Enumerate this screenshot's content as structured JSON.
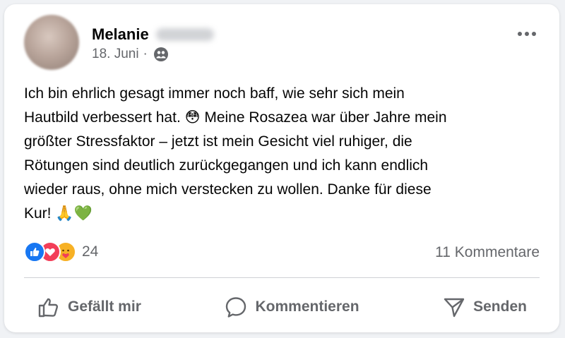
{
  "post": {
    "author_name": "Melanie",
    "date": "18. Juni",
    "separator": "·",
    "audience_icon": "friends-icon",
    "more_icon": "more-dots-icon",
    "text": "Ich bin ehrlich gesagt immer noch baff, wie sehr sich mein\nHautbild verbessert hat. 😳 Meine Rosazea war über Jahre mein\ngrößter Stressfaktor – jetzt ist mein Gesicht viel ruhiger, die\nRötungen sind deutlich zurückgegangen und ich kann endlich\nwieder raus, ohne mich verstecken zu wollen. Danke für diese\nKur! 🙏💚"
  },
  "reactions": {
    "icons": [
      "like-icon",
      "love-icon",
      "care-icon"
    ],
    "count": "24",
    "comments_label": "11 Kommentare"
  },
  "actions": {
    "like_label": "Gefällt mir",
    "comment_label": "Kommentieren",
    "share_label": "Senden"
  },
  "colors": {
    "like_blue": "#1877f2",
    "love_red": "#f33e58",
    "care_yellow": "#f7b125",
    "secondary_text": "#65676b"
  }
}
